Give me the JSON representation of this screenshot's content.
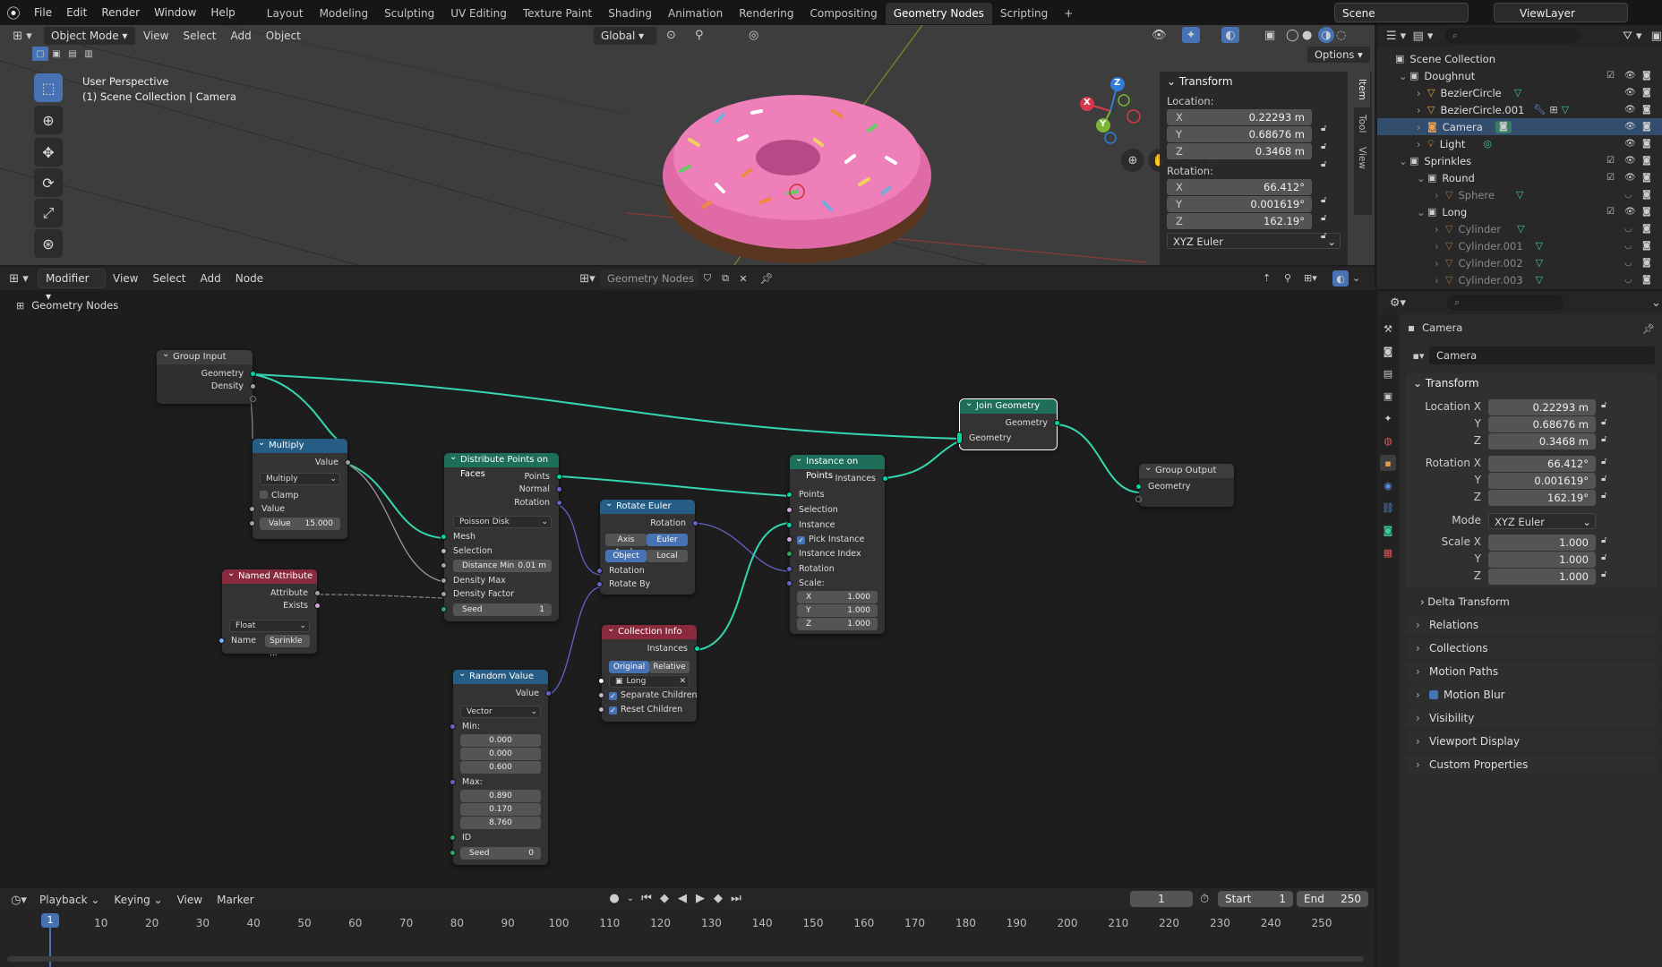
{
  "menu": [
    "File",
    "Edit",
    "Render",
    "Window",
    "Help"
  ],
  "workspaces": [
    "Layout",
    "Modeling",
    "Sculpting",
    "UV Editing",
    "Texture Paint",
    "Shading",
    "Animation",
    "Rendering",
    "Compositing",
    "Geometry Nodes",
    "Scripting"
  ],
  "workspace_add": "+",
  "scene": "Scene",
  "view_layer": "ViewLayer",
  "viewport": {
    "mode": "Object Mode",
    "menus": [
      "View",
      "Select",
      "Add",
      "Object"
    ],
    "orientation": "Global",
    "options": "Options",
    "overlay_title": "User Perspective",
    "overlay_sub": "(1) Scene Collection | Camera",
    "gizmo": {
      "x": "X",
      "y": "Y",
      "z": "Z"
    },
    "tabs": [
      "Item",
      "Tool",
      "View"
    ]
  },
  "npanel": {
    "title": "Transform",
    "location_label": "Location:",
    "location": [
      {
        "axis": "X",
        "value": "0.22293 m"
      },
      {
        "axis": "Y",
        "value": "0.68676 m"
      },
      {
        "axis": "Z",
        "value": "0.3468 m"
      }
    ],
    "rotation_label": "Rotation:",
    "rotation": [
      {
        "axis": "X",
        "value": "66.412°"
      },
      {
        "axis": "Y",
        "value": "0.001619°"
      },
      {
        "axis": "Z",
        "value": "162.19°"
      }
    ],
    "rot_mode": "XYZ Euler"
  },
  "outliner": {
    "root": "Scene Collection",
    "items": [
      "Doughnut",
      "BezierCircle",
      "BezierCircle.001",
      "Camera",
      "Light",
      "Sprinkles",
      "Round",
      "Sphere",
      "Long",
      "Cylinder",
      "Cylinder.001",
      "Cylinder.002",
      "Cylinder.003"
    ]
  },
  "node_editor": {
    "editor_type": "Modifier",
    "menus": [
      "View",
      "Select",
      "Add",
      "Node"
    ],
    "tree_name": "Geometry Nodes",
    "breadcrumb": "Geometry Nodes"
  },
  "nodes": {
    "group_input": {
      "title": "Group Input",
      "outs": [
        "Geometry",
        "Density"
      ]
    },
    "multiply": {
      "title": "Multiply",
      "out": "Value",
      "op": "Multiply",
      "clamp": "Clamp",
      "in_label": "Value",
      "field_label": "Value",
      "field_value": "15.000"
    },
    "named_attr": {
      "title": "Named Attribute",
      "outs": [
        "Attribute",
        "Exists"
      ],
      "type": "Float",
      "name_label": "Name",
      "name_value": "Sprinkle ..."
    },
    "distribute": {
      "title": "Distribute Points on Faces",
      "outs": [
        "Points",
        "Normal",
        "Rotation"
      ],
      "method": "Poisson Disk",
      "ins": [
        "Mesh",
        "Selection"
      ],
      "dist_label": "Distance Min",
      "dist_value": "0.01 m",
      "ins2": [
        "Density Max",
        "Density Factor"
      ],
      "seed_label": "Seed",
      "seed_value": "1"
    },
    "rotate": {
      "title": "Rotate Euler",
      "out": "Rotation",
      "t1a": "Axis Angle",
      "t1b": "Euler",
      "t2a": "Object",
      "t2b": "Local",
      "ins": [
        "Rotation",
        "Rotate By"
      ]
    },
    "random": {
      "title": "Random Value",
      "out": "Value",
      "type": "Vector",
      "min_label": "Min:",
      "min": [
        "0.000",
        "0.000",
        "0.600"
      ],
      "max_label": "Max:",
      "max": [
        "0.890",
        "0.170",
        "8.760"
      ],
      "id_label": "ID",
      "seed_label": "Seed",
      "seed_value": "0"
    },
    "collection": {
      "title": "Collection Info",
      "out": "Instances",
      "t1": "Original",
      "t2": "Relative",
      "coll": "Long",
      "c1": "Separate Children",
      "c2": "Reset Children"
    },
    "instance": {
      "title": "Instance on Points",
      "out": "Instances",
      "ins": [
        "Points",
        "Selection",
        "Instance"
      ],
      "pick": "Pick Instance",
      "ins2": [
        "Instance Index",
        "Rotation"
      ],
      "scale_label": "Scale:",
      "scale": [
        {
          "axis": "X",
          "value": "1.000"
        },
        {
          "axis": "Y",
          "value": "1.000"
        },
        {
          "axis": "Z",
          "value": "1.000"
        }
      ]
    },
    "join": {
      "title": "Join Geometry",
      "out": "Geometry",
      "in": "Geometry"
    },
    "group_output": {
      "title": "Group Output",
      "in": "Geometry"
    }
  },
  "properties": {
    "object_name": "Camera",
    "data_name": "Camera",
    "transform_title": "Transform",
    "location_x_label": "Location X",
    "loc": [
      "0.22293 m",
      "0.68676 m",
      "0.3468 m"
    ],
    "rotation_x_label": "Rotation X",
    "rot": [
      "66.412°",
      "0.001619°",
      "162.19°"
    ],
    "y_label": "Y",
    "z_label": "Z",
    "mode_label": "Mode",
    "mode_value": "XYZ Euler",
    "scale_x_label": "Scale X",
    "scale": [
      "1.000",
      "1.000",
      "1.000"
    ],
    "delta": "Delta Transform",
    "sections": [
      "Relations",
      "Collections",
      "Motion Paths",
      "Motion Blur",
      "Visibility",
      "Viewport Display",
      "Custom Properties"
    ]
  },
  "timeline": {
    "menus": [
      "Playback",
      "Keying",
      "View",
      "Marker"
    ],
    "current_frame": "1",
    "start_label": "Start",
    "start": "1",
    "end_label": "End",
    "end": "250",
    "ticks": [
      "10",
      "20",
      "30",
      "40",
      "50",
      "60",
      "70",
      "80",
      "90",
      "100",
      "110",
      "120",
      "130",
      "140",
      "150",
      "160",
      "170",
      "180",
      "190",
      "200",
      "210",
      "220",
      "230",
      "240",
      "250"
    ],
    "playhead": "1"
  },
  "colors": {
    "accent": "#4772b3",
    "geometry_socket": "#00d6a3",
    "node_geo": "#1e6e5a",
    "node_util": "#265d84",
    "node_input": "#8a2a3e"
  }
}
